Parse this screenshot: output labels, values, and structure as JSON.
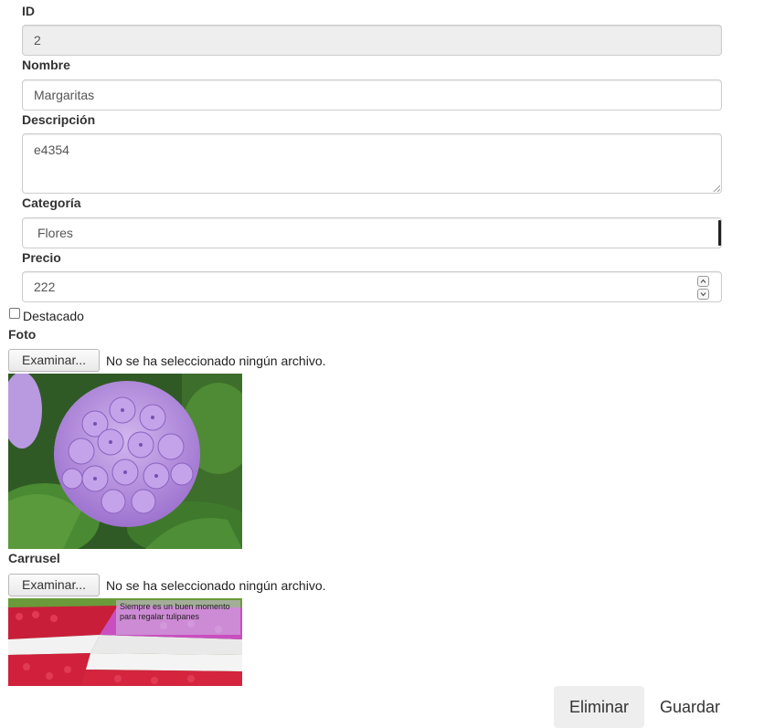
{
  "form": {
    "id": {
      "label": "ID",
      "value": "2"
    },
    "nombre": {
      "label": "Nombre",
      "value": "Margaritas"
    },
    "descripcion": {
      "label": "Descripción",
      "value": "e4354"
    },
    "categoria": {
      "label": "Categoría",
      "value": "Flores"
    },
    "precio": {
      "label": "Precio",
      "value": "222"
    },
    "destacado": {
      "label": "Destacado",
      "checked": false
    },
    "foto": {
      "label": "Foto",
      "button_label": "Examinar...",
      "status": "No se ha seleccionado ningún archivo."
    },
    "carrusel": {
      "label": "Carrusel",
      "button_label": "Examinar...",
      "status": "No se ha seleccionado ningún archivo.",
      "image_caption": "Siempre es un buen momento para regalar tulipanes"
    }
  },
  "actions": {
    "delete_label": "Eliminar",
    "save_label": "Guardar"
  },
  "colors": {
    "readonly_bg": "#eeeeee",
    "border": "#cccccc",
    "delete_bg": "#eeeeee",
    "hydrangea": "#b18ad9",
    "tulip_red": "#d21f3c",
    "tulip_pink": "#c84fbf"
  }
}
